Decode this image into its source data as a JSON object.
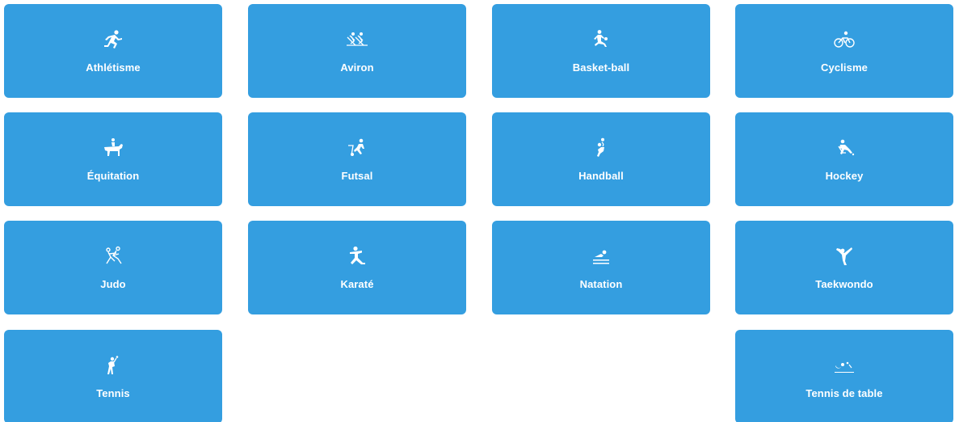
{
  "theme": {
    "tile_color": "#349ee0",
    "text_color": "#ffffff"
  },
  "sports": [
    {
      "label": "Athlétisme",
      "icon": "running-icon"
    },
    {
      "label": "Aviron",
      "icon": "rowing-icon"
    },
    {
      "label": "Basket-ball",
      "icon": "basketball-icon"
    },
    {
      "label": "Cyclisme",
      "icon": "cycling-icon"
    },
    {
      "label": "Équitation",
      "icon": "horse-riding-icon"
    },
    {
      "label": "Futsal",
      "icon": "futsal-icon"
    },
    {
      "label": "Handball",
      "icon": "handball-icon"
    },
    {
      "label": "Hockey",
      "icon": "hockey-icon"
    },
    {
      "label": "Judo",
      "icon": "judo-icon"
    },
    {
      "label": "Karaté",
      "icon": "karate-icon"
    },
    {
      "label": "Natation",
      "icon": "swimming-icon"
    },
    {
      "label": "Taekwondo",
      "icon": "taekwondo-icon"
    },
    {
      "label": "Tennis",
      "icon": "tennis-icon"
    },
    {
      "label": "Tennis de table",
      "icon": "table-tennis-icon"
    }
  ]
}
